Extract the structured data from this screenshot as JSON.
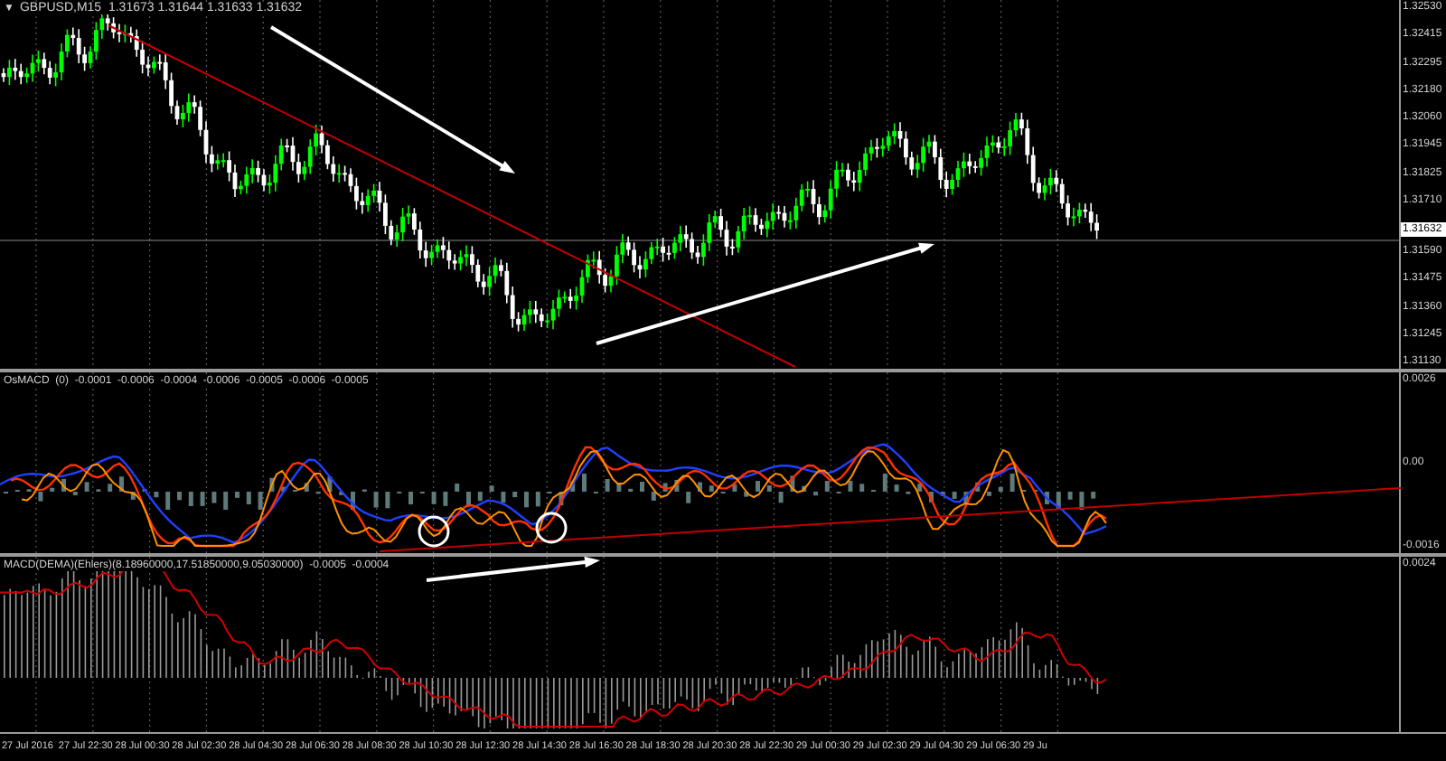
{
  "main_chart": {
    "collapse_icon": "▼",
    "title": "GBPUSD,M15  1.31673 1.31644 1.31633 1.31632",
    "price_axis": [
      "1.32530",
      "1.32415",
      "1.32295",
      "1.32180",
      "1.32060",
      "1.31945",
      "1.31825",
      "1.31710",
      "1.31590",
      "1.31475",
      "1.31360",
      "1.31245",
      "1.31130"
    ],
    "current_price": "1.31632"
  },
  "indicator_1": {
    "title": "OsMACD  (0)  -0.0001  -0.0006  -0.0004  -0.0006  -0.0005  -0.0006  -0.0005",
    "axis": [
      "0.0026",
      "0.00",
      "-0.0016"
    ]
  },
  "indicator_2": {
    "title": "MACD(DEMA)(Ehlers)(8.18960000,17.51850000,9.05030000)  -0.0005  -0.0004",
    "axis": [
      "0.0024"
    ]
  },
  "time_axis": [
    "27 Jul 2016",
    "27 Jul 22:30",
    "28 Jul 00:30",
    "28 Jul 02:30",
    "28 Jul 04:30",
    "28 Jul 06:30",
    "28 Jul 08:30",
    "28 Jul 10:30",
    "28 Jul 12:30",
    "28 Jul 14:30",
    "28 Jul 16:30",
    "28 Jul 18:30",
    "28 Jul 20:30",
    "28 Jul 22:30",
    "29 Jul 00:30",
    "29 Jul 02:30",
    "29 Jul 04:30",
    "29 Jul 06:30",
    "29 Ju"
  ]
}
